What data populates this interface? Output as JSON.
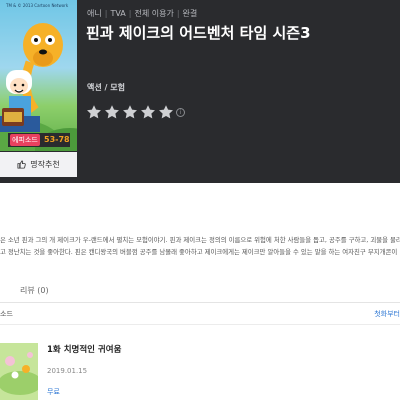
{
  "header": {
    "meta": [
      "애니",
      "TVA",
      "전체 이용가",
      "완결"
    ],
    "title": "핀과 제이크의 어드벤처 타임 시즌3",
    "genre": "액션 / 모험",
    "rating_stars": 5,
    "star_color": "#cfd0d3",
    "info_symbol": "i"
  },
  "poster": {
    "copyright": "TM & © 2013 Cartoon Network",
    "episode_badge": "에피소드",
    "episode_count": "53-78",
    "recommend_label": "명작추천",
    "recommend_icon": "thumbs-up-icon"
  },
  "description": {
    "text": "은 소년 핀과 그의 개 제이크가 우-랜드에서 펼치는 모험이야기. 핀과 제이크는 정의의 이름으로 위험에 처한 사람들을 돕고, 공주를 구하고, 괴물을 물리\n고 정난치는 것을 좋아한다. 핀은 캔디왕국의 버블껌 공주를 남몰래 좋아하고 제이크에게는 제이크만 알아들을 수 있는 말을 하는 여자친구 무지개콘이"
  },
  "reviews": {
    "label": "리뷰 (0)"
  },
  "episodes": {
    "section_label": "소드",
    "sort_label": "첫화부터",
    "items": [
      {
        "title": "1화 치명적인 귀여움",
        "date": "2019.01.15",
        "price": "무료"
      }
    ]
  },
  "colors": {
    "accent_pink": "#e8415f",
    "accent_orange": "#f0a020",
    "link_blue": "#2f78d4",
    "header_bg": "#2a2b2e"
  }
}
